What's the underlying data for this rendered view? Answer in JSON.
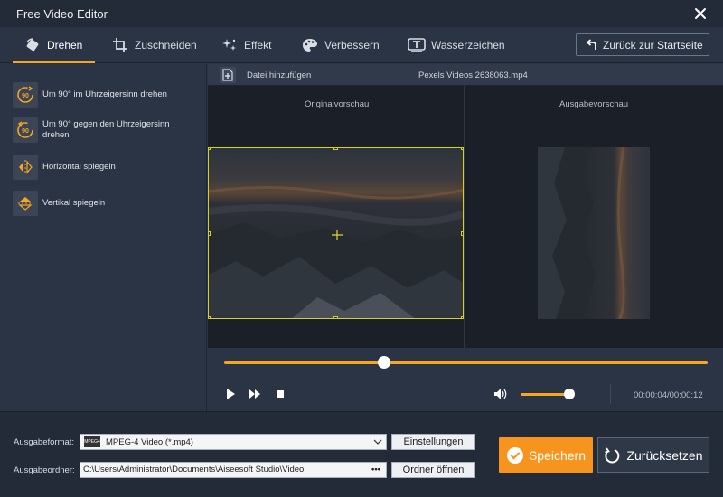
{
  "window": {
    "title": "Free Video Editor"
  },
  "tabs": [
    {
      "label": "Drehen",
      "icon": "rotate-icon"
    },
    {
      "label": "Zuschneiden",
      "icon": "crop-icon"
    },
    {
      "label": "Effekt",
      "icon": "sparkle-icon"
    },
    {
      "label": "Verbessern",
      "icon": "palette-icon"
    },
    {
      "label": "Wasserzeichen",
      "icon": "watermark-icon"
    }
  ],
  "home_button": {
    "label": "Zurück zur Startseite"
  },
  "rotate_options": [
    {
      "label": "Um 90° im Uhrzeigersinn drehen",
      "icon": "rotate-cw-90-icon",
      "badge": "90"
    },
    {
      "label": "Um 90° gegen den Uhrzeigersinn drehen",
      "icon": "rotate-ccw-90-icon",
      "badge": "90"
    },
    {
      "label": "Horizontal spiegeln",
      "icon": "flip-horizontal-icon"
    },
    {
      "label": "Vertikal spiegeln",
      "icon": "flip-vertical-icon"
    }
  ],
  "file_bar": {
    "add_label": "Datei hinzufügen",
    "filename": "Pexels Videos 2638063.mp4"
  },
  "preview": {
    "original_label": "Originalvorschau",
    "output_label": "Ausgabevorschau"
  },
  "playback": {
    "progress": 0.33,
    "volume": 0.9,
    "timecode": "00:00:04/00:00:12"
  },
  "output": {
    "format_label": "Ausgabeformat:",
    "format_value": "MPEG-4 Video (*.mp4)",
    "format_badge": "MPEG4",
    "settings_label": "Einstellungen",
    "folder_label": "Ausgabeordner:",
    "folder_value": "C:\\Users\\Administrator\\Documents\\Aiseesoft Studio\\Video",
    "folder_dots": "•••",
    "open_folder_label": "Ordner öffnen"
  },
  "actions": {
    "save_label": "Speichern",
    "reset_label": "Zurücksetzen"
  },
  "colors": {
    "accent": "#f7941d",
    "crop_border": "#d9cf1f",
    "background": "#2b3444"
  }
}
